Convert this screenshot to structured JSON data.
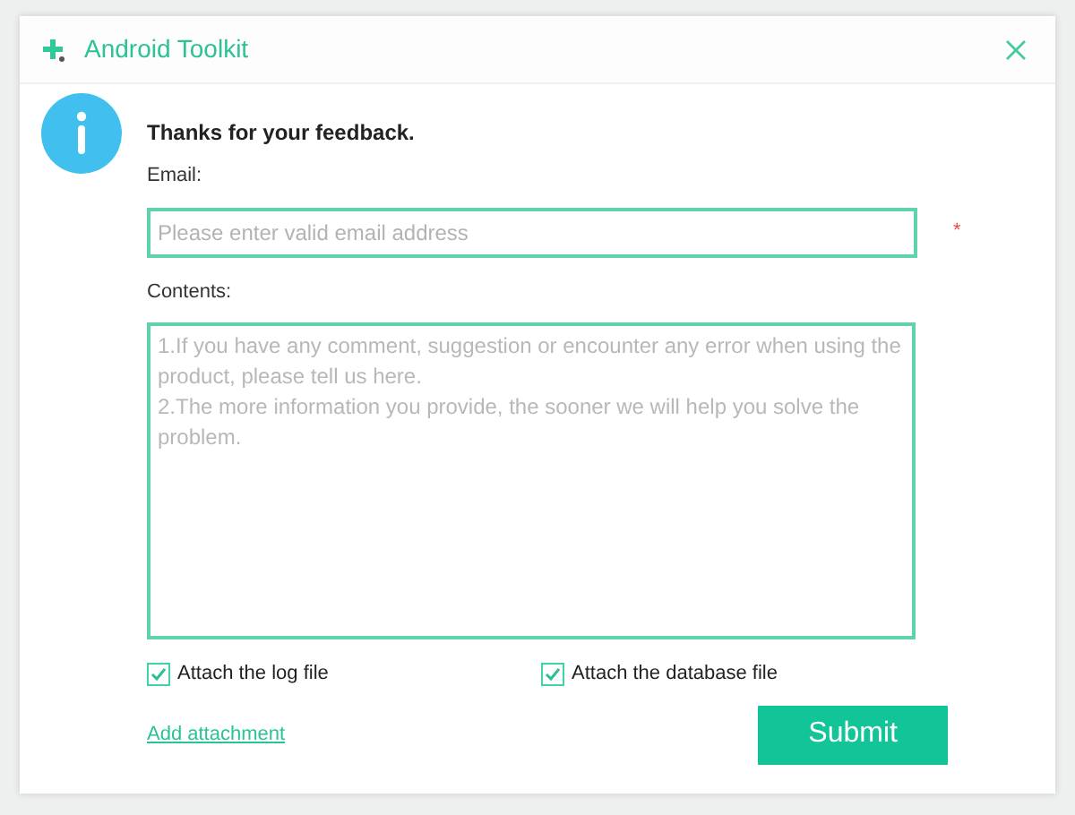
{
  "window": {
    "title": "Android Toolkit"
  },
  "heading": "Thanks for your feedback.",
  "email": {
    "label": "Email:",
    "placeholder": "Please enter valid email address",
    "required_mark": "*"
  },
  "contents": {
    "label": "Contents:",
    "placeholder": "1.If you have any comment, suggestion or encounter any error when using the product, please tell us here.\n2.The more information you provide, the sooner we will help you solve the problem."
  },
  "options": [
    {
      "label": "Attach the log file",
      "checked": true
    },
    {
      "label": "Attach the database file",
      "checked": true
    }
  ],
  "add_attachment": "Add attachment",
  "submit": "Submit"
}
